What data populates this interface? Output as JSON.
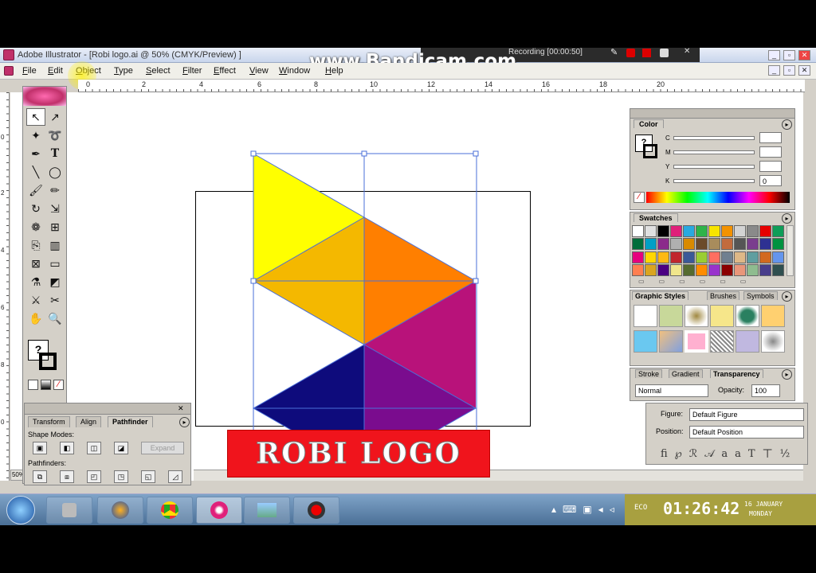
{
  "window": {
    "title": "Adobe Illustrator - [Robi logo.ai @ 50% (CMYK/Preview) ]"
  },
  "recorder": {
    "watermark": "www.Bandicam.com",
    "status": "Recording [00:00:50]"
  },
  "menu": {
    "items": [
      "File",
      "Edit",
      "Object",
      "Type",
      "Select",
      "Filter",
      "Effect",
      "View",
      "Window",
      "Help"
    ]
  },
  "ruler": {
    "h_ticks": [
      "0",
      "2",
      "4",
      "6",
      "8",
      "10",
      "12",
      "14",
      "16",
      "18",
      "20"
    ],
    "v_ticks": [
      "0",
      "2",
      "4",
      "6",
      "8",
      "0"
    ]
  },
  "zoom": "50%",
  "pathfinder": {
    "tabs": [
      "Transform",
      "Align",
      "Pathfinder"
    ],
    "shape_modes": "Shape Modes:",
    "expand": "Expand",
    "pathfinders": "Pathfinders:"
  },
  "color_panel": {
    "tab": "Color",
    "labels": [
      "C",
      "M",
      "Y",
      "K"
    ],
    "k_value": "0"
  },
  "swatches": {
    "tab": "Swatches",
    "colors": [
      "#ffffff",
      "#e0e0e0",
      "#000000",
      "#e0207a",
      "#29a9e0",
      "#2fb34a",
      "#f7e400",
      "#f39200",
      "#d3d3d3",
      "#8a8a8a",
      "#e60000",
      "#0f9d58",
      "#006d3a",
      "#00a0c6",
      "#8b2a8b",
      "#b0b0b0",
      "#d98a00",
      "#6b4a2a",
      "#a88c5c",
      "#c26b3d",
      "#555555",
      "#7a3d8e",
      "#2e3192",
      "#00923f",
      "#e6007e",
      "#ffd700",
      "#fdb913",
      "#c1272d",
      "#3b5998",
      "#9acd32",
      "#ff6f61",
      "#708090",
      "#deb887",
      "#5f9ea0",
      "#d2691e",
      "#6495ed",
      "#ff7f50",
      "#daa520",
      "#4b0082",
      "#f0e68c",
      "#556b2f",
      "#ff8c00",
      "#9932cc",
      "#8b0000",
      "#e9967a",
      "#8fbc8f",
      "#483d8b",
      "#2f4f4f"
    ]
  },
  "graphic_styles": {
    "tabs": [
      "Graphic Styles",
      "Brushes",
      "Symbols"
    ]
  },
  "transparency": {
    "tabs": [
      "Stroke",
      "Gradient",
      "Transparency"
    ],
    "mode": "Normal",
    "opacity_label": "Opacity:",
    "opacity": "100"
  },
  "type_panel": {
    "figure_label": "Figure:",
    "figure": "Default Figure",
    "position_label": "Position:",
    "position": "Default Position"
  },
  "logo": {
    "text": "ROBI LOGO",
    "colors": {
      "yellow": "#ffff00",
      "gold": "#f4b800",
      "orange": "#ff7f00",
      "magenta": "#b8127a",
      "navy": "#0e0b7c",
      "purple": "#7a0c8e"
    }
  },
  "taskbar": {
    "time": "01:26:42",
    "day": "16 JANUARY",
    "year": "MONDAY",
    "extra": "ECO"
  }
}
